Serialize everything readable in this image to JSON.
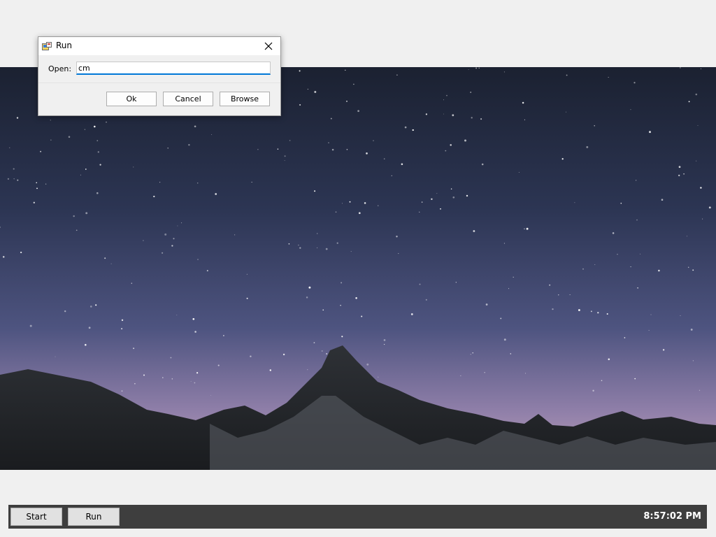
{
  "dialog": {
    "title": "Run",
    "open_label": "Open:",
    "open_value": "cm",
    "buttons": {
      "ok": "Ok",
      "cancel": "Cancel",
      "browse": "Browse"
    }
  },
  "taskbar": {
    "start_label": "Start",
    "run_label": "Run",
    "clock": "8:57:02 PM"
  },
  "icons": {
    "title": "run-app-icon",
    "close": "close-icon"
  },
  "colors": {
    "input_focus_border": "#0078d7",
    "taskbar_bg": "#3e3e3e"
  }
}
